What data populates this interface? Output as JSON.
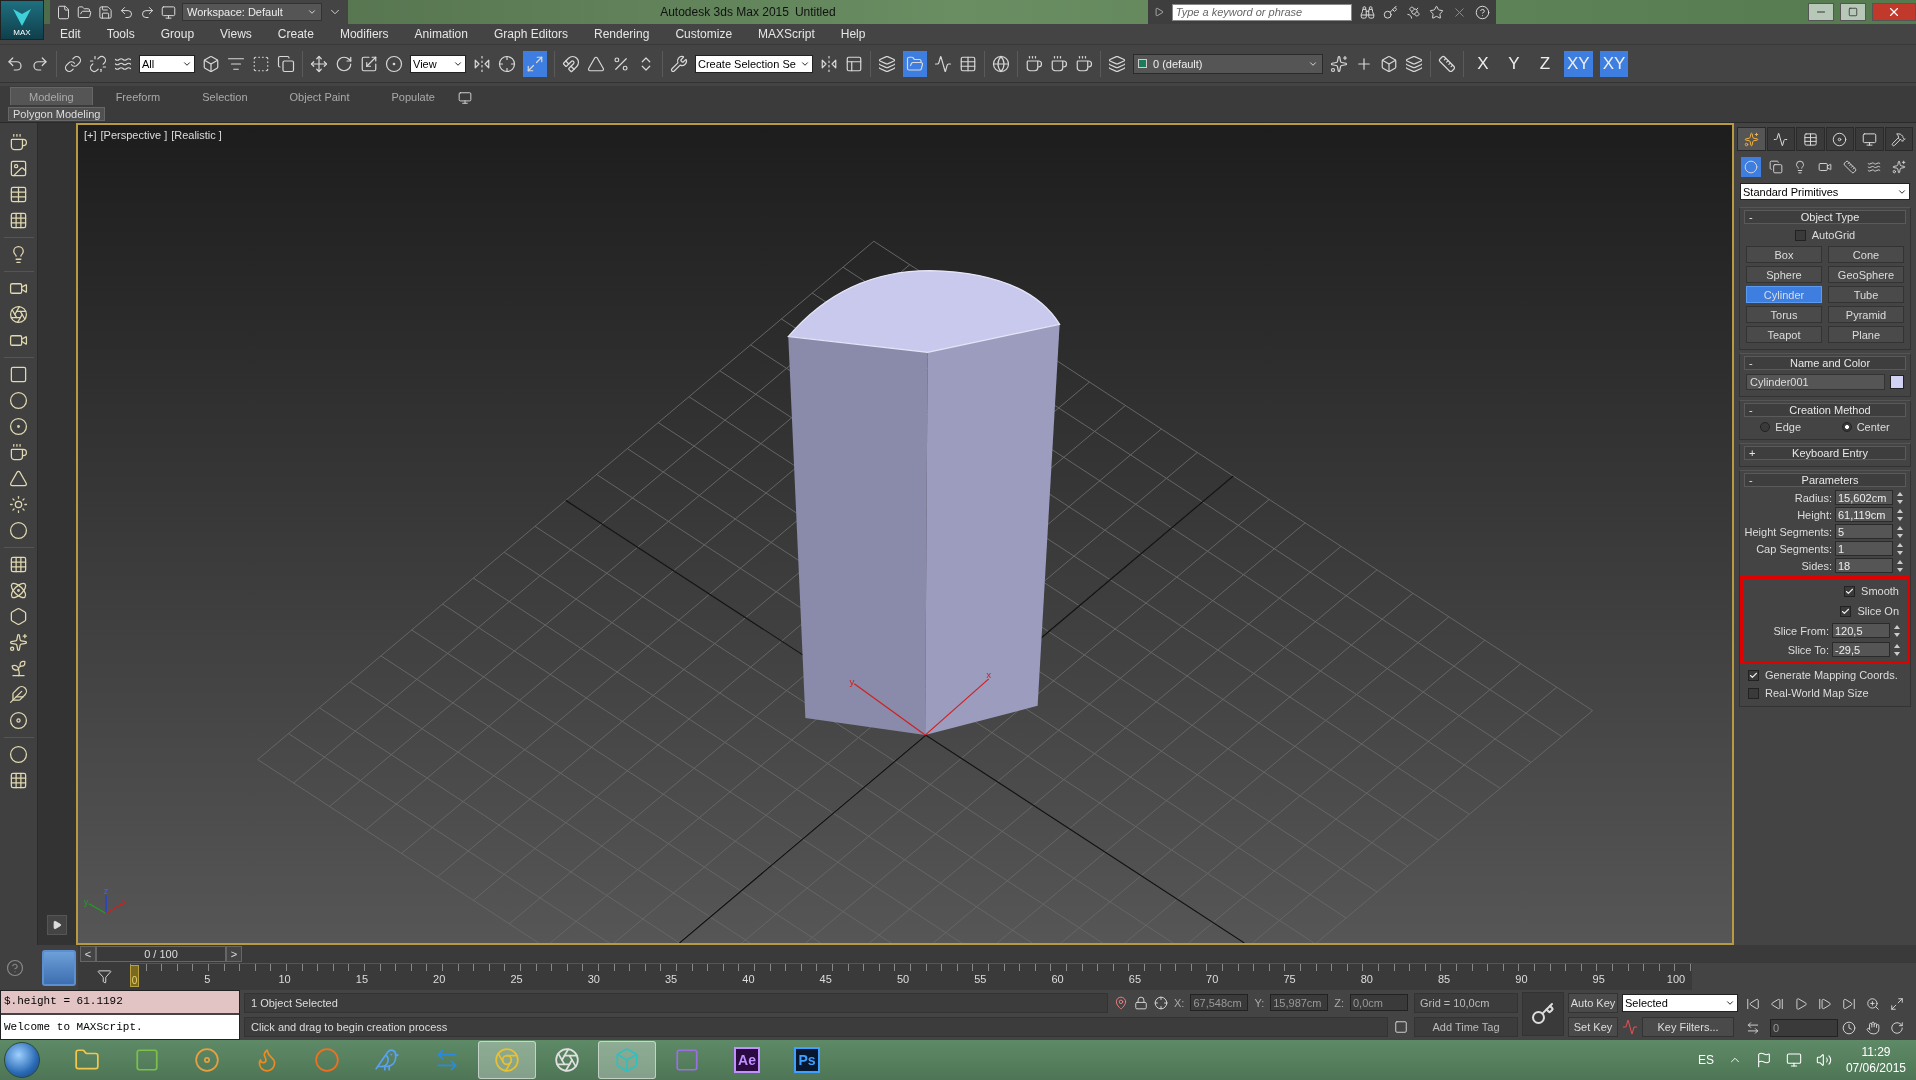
{
  "title_bar": {
    "app_menu": "MAX",
    "workspace": "Workspace: Default",
    "app_title": "Autodesk 3ds Max  2015",
    "document": "Untitled",
    "search": {
      "placeholder": "Type a keyword or phrase"
    }
  },
  "menu_bar": [
    "Edit",
    "Tools",
    "Group",
    "Views",
    "Create",
    "Modifiers",
    "Animation",
    "Graph Editors",
    "Rendering",
    "Customize",
    "MAXScript",
    "Help"
  ],
  "main_toolbar": {
    "selection_filter": "All",
    "reference_coordinate": "View",
    "named_selection": "Create Selection Se",
    "layer": "0 (default)",
    "axis_constraints": [
      {
        "label": "X",
        "selected": false
      },
      {
        "label": "Y",
        "selected": false
      },
      {
        "label": "Z",
        "selected": false
      },
      {
        "label": "XY",
        "selected": true
      },
      {
        "label": "XY",
        "selected": true
      }
    ]
  },
  "ribbon": {
    "tabs": [
      {
        "label": "Modeling",
        "selected": true
      },
      {
        "label": "Freeform",
        "selected": false
      },
      {
        "label": "Selection",
        "selected": false
      },
      {
        "label": "Object Paint",
        "selected": false
      },
      {
        "label": "Populate",
        "selected": false
      }
    ],
    "panel": "Polygon Modeling"
  },
  "viewport": {
    "labels": [
      "[+]",
      "[Perspective ]",
      "[Realistic ]"
    ],
    "gizmo_axes": [
      "y",
      "x"
    ],
    "axis_tripod": [
      "y",
      "z",
      "x"
    ]
  },
  "command_panel": {
    "category": "Standard Primitives",
    "object_type": {
      "toggle": "-",
      "title": "Object Type",
      "autogrid": {
        "label": "AutoGrid",
        "checked": false
      },
      "buttons": [
        {
          "label": "Box",
          "selected": false
        },
        {
          "label": "Cone",
          "selected": false
        },
        {
          "label": "Sphere",
          "selected": false
        },
        {
          "label": "GeoSphere",
          "selected": false
        },
        {
          "label": "Cylinder",
          "selected": true
        },
        {
          "label": "Tube",
          "selected": false
        },
        {
          "label": "Torus",
          "selected": false
        },
        {
          "label": "Pyramid",
          "selected": false
        },
        {
          "label": "Teapot",
          "selected": false
        },
        {
          "label": "Plane",
          "selected": false
        }
      ]
    },
    "name_and_color": {
      "toggle": "-",
      "title": "Name and Color",
      "name": "Cylinder001"
    },
    "creation_method": {
      "toggle": "-",
      "title": "Creation Method",
      "options": [
        {
          "label": "Edge",
          "selected": false
        },
        {
          "label": "Center",
          "selected": true
        }
      ]
    },
    "keyboard_entry": {
      "toggle": "+",
      "title": "Keyboard Entry"
    },
    "parameters": {
      "toggle": "-",
      "title": "Parameters",
      "fields": [
        {
          "label": "Radius:",
          "value": "15,602cm"
        },
        {
          "label": "Height:",
          "value": "61,119cm"
        },
        {
          "label": "Height Segments:",
          "value": "5"
        },
        {
          "label": "Cap Segments:",
          "value": "1"
        },
        {
          "label": "Sides:",
          "value": "18"
        }
      ],
      "highlighted": {
        "checkboxes": [
          {
            "label": "Smooth",
            "checked": true
          },
          {
            "label": "Slice On",
            "checked": true
          }
        ],
        "fields": [
          {
            "label": "Slice From:",
            "value": "120,5"
          },
          {
            "label": "Slice To:",
            "value": "-29,5"
          }
        ]
      },
      "options": [
        {
          "label": "Generate Mapping Coords.",
          "checked": true
        },
        {
          "label": "Real-World Map Size",
          "checked": false
        }
      ]
    }
  },
  "time_slider": {
    "prev": "<",
    "position": "0 / 100",
    "next": ">"
  },
  "trackbar": {
    "ticks": [
      "0",
      "5",
      "10",
      "15",
      "20",
      "25",
      "30",
      "35",
      "40",
      "45",
      "50",
      "55",
      "60",
      "65",
      "70",
      "75",
      "80",
      "85",
      "90",
      "95",
      "100"
    ]
  },
  "listener": {
    "input": "$.height = 61.1192",
    "output": "Welcome to MAXScript."
  },
  "status": {
    "selection": "1 Object Selected",
    "prompt": "Click and drag to begin creation process",
    "coordinates": [
      {
        "axis": "X:",
        "value": "67,548cm"
      },
      {
        "axis": "Y:",
        "value": "15,987cm"
      },
      {
        "axis": "Z:",
        "value": "0,0cm"
      }
    ],
    "grid": "Grid = 10,0cm",
    "time_tag": "Add Time Tag"
  },
  "animation": {
    "auto_key": "Auto Key",
    "set_key": "Set Key",
    "key_mode": "Selected",
    "key_filters": "Key Filters...",
    "frame": "0"
  },
  "taskbar": {
    "apps": [
      {
        "selected": false
      },
      {
        "selected": false
      },
      {
        "selected": false
      },
      {
        "selected": false
      },
      {
        "selected": false
      },
      {
        "selected": false
      },
      {
        "selected": false
      },
      {
        "selected": true
      },
      {
        "selected": false
      },
      {
        "selected": true
      },
      {
        "selected": false
      },
      {
        "selected": false,
        "label": "Ae"
      },
      {
        "selected": false,
        "label": "Ps"
      }
    ],
    "language": "ES",
    "time": "11:29",
    "date": "07/06/2015"
  }
}
